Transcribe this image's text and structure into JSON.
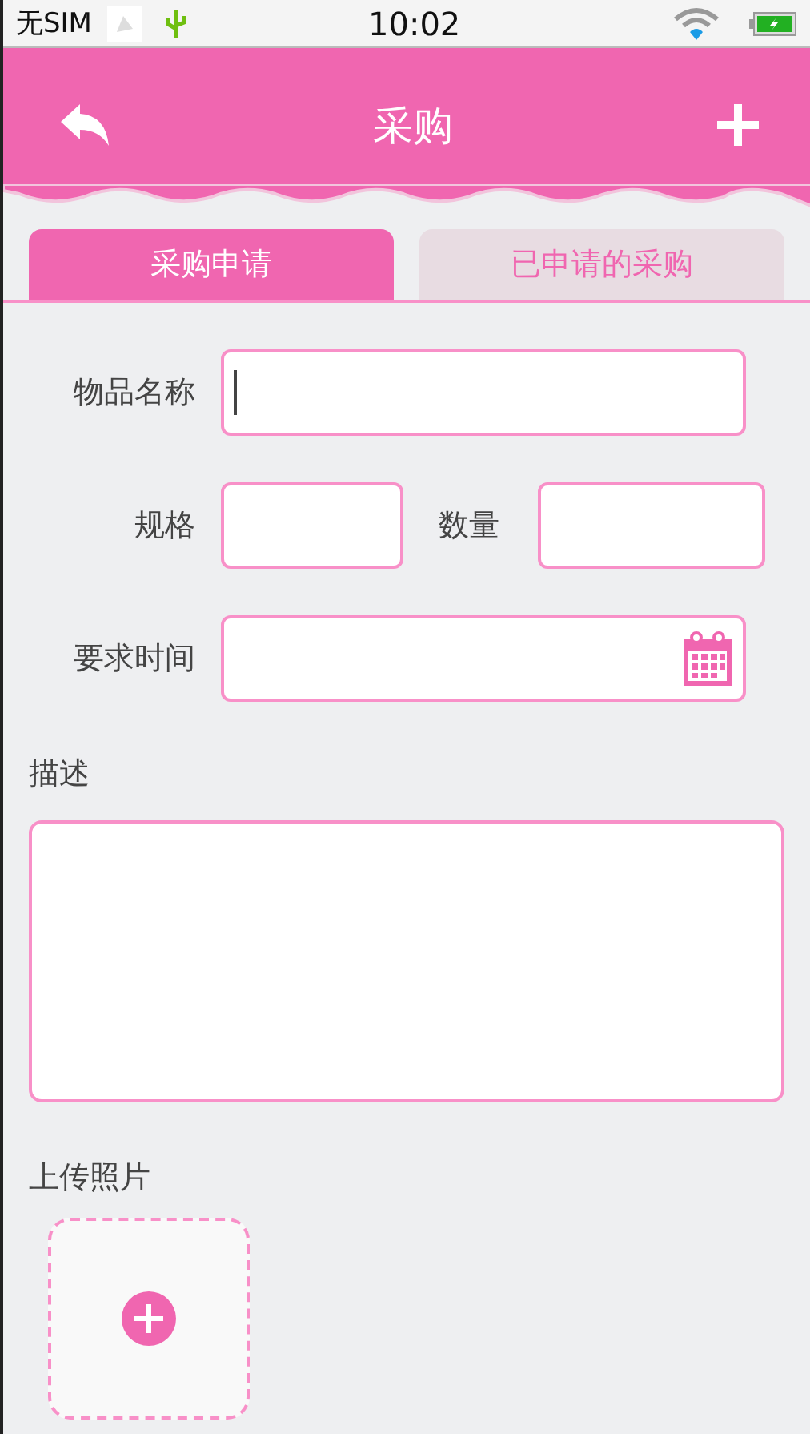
{
  "status_bar": {
    "carrier": "无SIM",
    "time": "10:02"
  },
  "header": {
    "title": "采购"
  },
  "tabs": [
    {
      "label": "采购申请",
      "selected": true
    },
    {
      "label": "已申请的采购",
      "selected": false
    }
  ],
  "form": {
    "item_name": {
      "label": "物品名称",
      "focused": true
    },
    "spec": {
      "label": "规格"
    },
    "quantity": {
      "label": "数量"
    },
    "required_time": {
      "label": "要求时间"
    },
    "description": {
      "label": "描述"
    },
    "upload": {
      "label": "上传照片"
    }
  }
}
